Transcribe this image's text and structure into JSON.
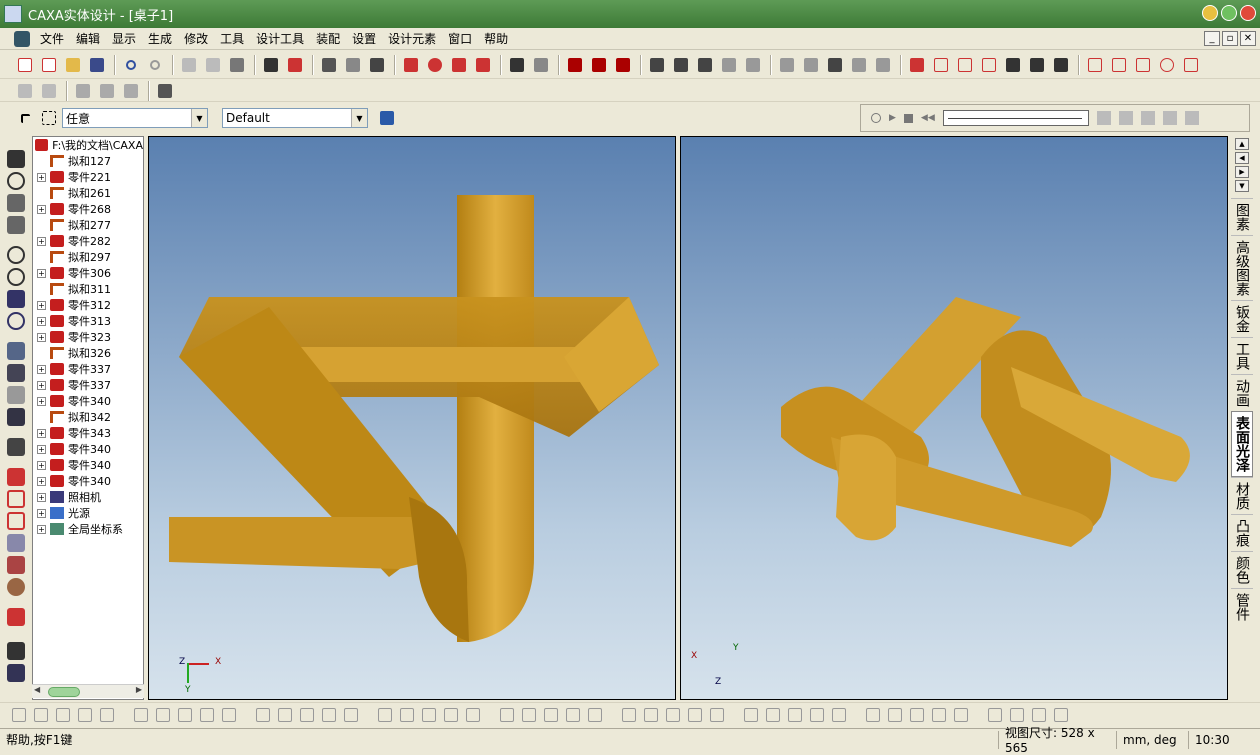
{
  "window": {
    "title": "CAXA实体设计 - [桌子1]"
  },
  "menu": [
    "文件",
    "编辑",
    "显示",
    "生成",
    "修改",
    "工具",
    "设计工具",
    "装配",
    "设置",
    "设计元素",
    "窗口",
    "帮助"
  ],
  "selection": {
    "filter_value": "任意",
    "config_value": "Default"
  },
  "tree": {
    "root": "F:\\我的文档\\CAXA",
    "items": [
      {
        "type": "fit",
        "label": "拟和127"
      },
      {
        "type": "part",
        "label": "零件221"
      },
      {
        "type": "fit",
        "label": "拟和261"
      },
      {
        "type": "part",
        "label": "零件268"
      },
      {
        "type": "fit",
        "label": "拟和277"
      },
      {
        "type": "part",
        "label": "零件282"
      },
      {
        "type": "fit",
        "label": "拟和297"
      },
      {
        "type": "part",
        "label": "零件306"
      },
      {
        "type": "fit",
        "label": "拟和311"
      },
      {
        "type": "part",
        "label": "零件312"
      },
      {
        "type": "part",
        "label": "零件313"
      },
      {
        "type": "part",
        "label": "零件323"
      },
      {
        "type": "fit",
        "label": "拟和326"
      },
      {
        "type": "part",
        "label": "零件337"
      },
      {
        "type": "part",
        "label": "零件337"
      },
      {
        "type": "part",
        "label": "零件340"
      },
      {
        "type": "fit",
        "label": "拟和342"
      },
      {
        "type": "part",
        "label": "零件343"
      },
      {
        "type": "part",
        "label": "零件340"
      },
      {
        "type": "part",
        "label": "零件340"
      },
      {
        "type": "part",
        "label": "零件340"
      },
      {
        "type": "camera",
        "label": "照相机"
      },
      {
        "type": "light",
        "label": "光源"
      },
      {
        "type": "coord",
        "label": "全局坐标系"
      }
    ]
  },
  "axes": {
    "x": "X",
    "y": "Y",
    "z": "Z"
  },
  "right_tabs": [
    "图素",
    "高级图素",
    "钣金",
    "工具",
    "动画",
    "表面光泽",
    "材质",
    "凸痕",
    "颜色",
    "管件"
  ],
  "active_right_tab": "表面光泽",
  "status": {
    "help": "帮助,按F1键",
    "view_size_label": "视图尺寸: 528 x 565",
    "units": "mm, deg",
    "time": "10:30"
  },
  "colors": {
    "ribbon_gold": "#d8a22a",
    "titlebar": "#3d7a36"
  }
}
